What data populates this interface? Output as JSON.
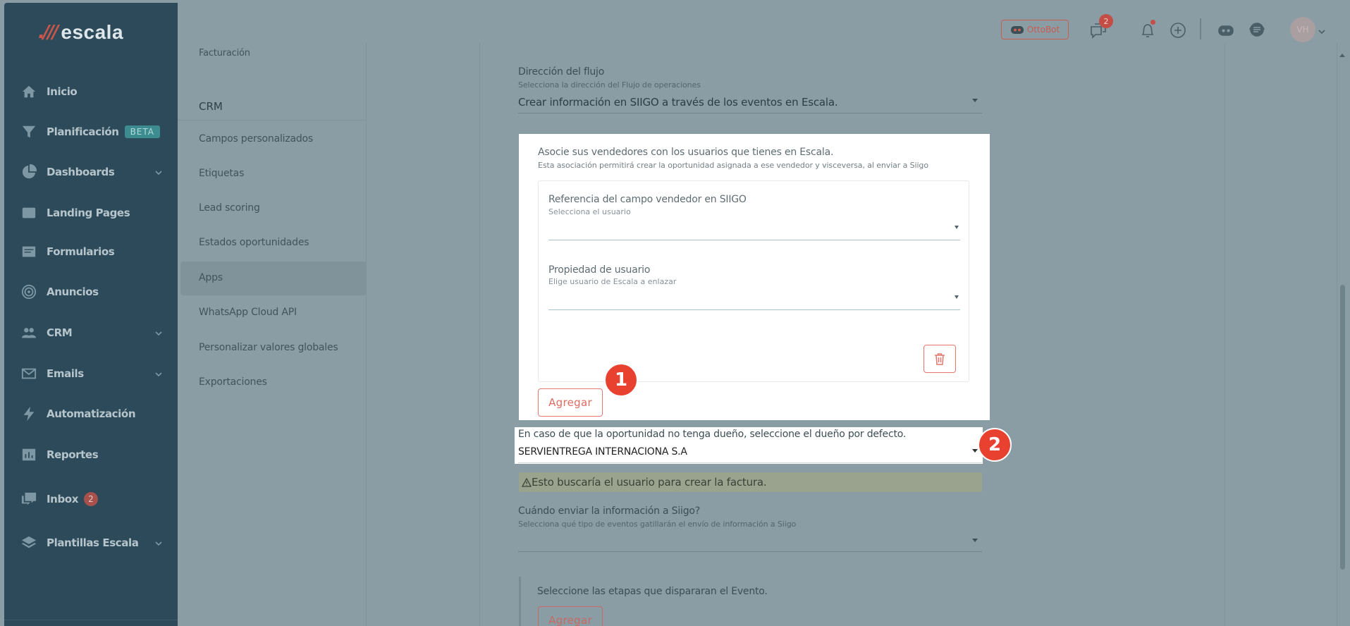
{
  "brand": {
    "logo_mark": ".///",
    "name": "escala"
  },
  "sidebar": {
    "items": [
      {
        "label": "Inicio",
        "icon": "home-icon"
      },
      {
        "label": "Planificación",
        "icon": "filter-icon",
        "badge": "BETA"
      },
      {
        "label": "Dashboards",
        "icon": "pie-chart-icon",
        "chevron": true
      },
      {
        "label": "Landing Pages",
        "icon": "landing-page-icon"
      },
      {
        "label": "Formularios",
        "icon": "form-icon"
      },
      {
        "label": "Anuncios",
        "icon": "target-icon"
      },
      {
        "label": "CRM",
        "icon": "people-icon",
        "chevron": true
      },
      {
        "label": "Emails",
        "icon": "mail-icon",
        "chevron": true
      },
      {
        "label": "Automatización",
        "icon": "bolt-icon"
      },
      {
        "label": "Reportes",
        "icon": "report-icon"
      },
      {
        "label": "Inbox",
        "icon": "inbox-icon",
        "badge": "2"
      },
      {
        "label": "Plantillas Escala",
        "icon": "layers-icon",
        "chevron": true
      }
    ]
  },
  "topbar": {
    "ottobot_label": "OttoBot",
    "chat_badge": "2",
    "avatar_initials": "VH"
  },
  "submenu": {
    "top_item": "Facturación",
    "section_heading": "CRM",
    "items": [
      "Campos personalizados",
      "Etiquetas",
      "Lead scoring",
      "Estados oportunidades",
      "Apps",
      "WhatsApp Cloud API",
      "Personalizar valores globales",
      "Exportaciones"
    ],
    "active": "Apps"
  },
  "form": {
    "flow_direction": {
      "label": "Dirección del flujo",
      "hint": "Selecciona la dirección del Flujo de operaciones",
      "value": "Crear información en SIIGO a través de los eventos en Escala."
    },
    "sellers": {
      "title": "Asocie sus vendedores con los usuarios que tienes en Escala.",
      "hint": "Esta asociación permitirá crear la oportunidad asignada a ese vendedor y visceversa, al enviar a Siigo",
      "siigo_field": {
        "label": "Referencia del campo vendedor en SIIGO",
        "hint": "Selecciona el usuario",
        "value": ""
      },
      "user_property": {
        "label": "Propiedad de usuario",
        "hint": "Elige usuario de Escala a enlazar",
        "value": ""
      },
      "add_label": "Agregar"
    },
    "default_owner": {
      "label": "En caso de que la oportunidad no tenga dueño, seleccione el dueño por defecto.",
      "value": "SERVIENTREGA INTERNACIONA S.A"
    },
    "warning": "Esto buscaría el usuario para crear la factura.",
    "send_when": {
      "label": "Cuándo enviar la información a Siigo?",
      "hint": "Selecciona qué tipo de eventos gatillarán el envío de información a Siigo",
      "value": ""
    },
    "stages": {
      "label": "Seleccione las etapas que dispararan el Evento.",
      "add_label": "Agregar"
    }
  },
  "annotations": {
    "step1": "1",
    "step2": "2"
  },
  "colors": {
    "accent": "#e8412f",
    "sidebar": "#2c4a59",
    "button": "#e06b61",
    "overlay": "#8a9ca4"
  }
}
